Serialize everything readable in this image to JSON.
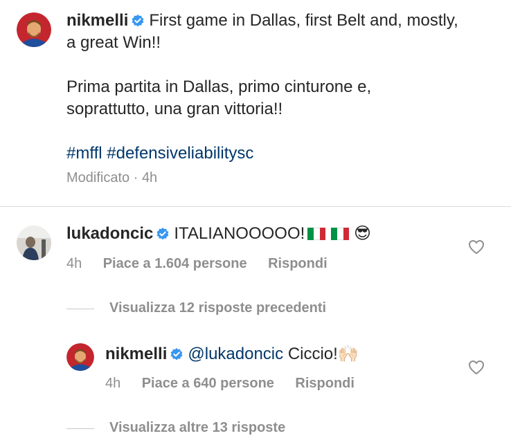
{
  "post": {
    "username": "nikmelli",
    "caption_en_line1": "First game in Dallas, first Belt and, mostly,",
    "caption_en_line2": "a great Win!!",
    "caption_it_line1": "Prima partita in Dallas, primo cinturone e,",
    "caption_it_line2": "soprattutto, una gran vittoria!!",
    "hashtags": [
      "#mffl",
      "#defensiveliabilitysc"
    ],
    "edited": "Modificato",
    "time": "4h"
  },
  "comments": [
    {
      "username": "lukadoncic",
      "text": "ITALIANOOOOO!",
      "emoji": "😎",
      "time": "4h",
      "likes": "Piace a 1.604 persone",
      "reply": "Rispondi",
      "view_previous": "Visualizza 12 risposte precedenti"
    },
    {
      "username": "nikmelli",
      "mention": "@lukadoncic",
      "text": "Ciccio!",
      "emoji": "🙌🏻",
      "time": "4h",
      "likes": "Piace a 640 persone",
      "reply": "Rispondi",
      "view_more": "Visualizza altre 13 risposte"
    }
  ],
  "colors": {
    "verified": "#3897f0",
    "hashtag": "#00376b",
    "meta": "#8e8e8e"
  },
  "icons": [
    "verified-badge-icon",
    "heart-icon",
    "italy-flag-icon"
  ]
}
